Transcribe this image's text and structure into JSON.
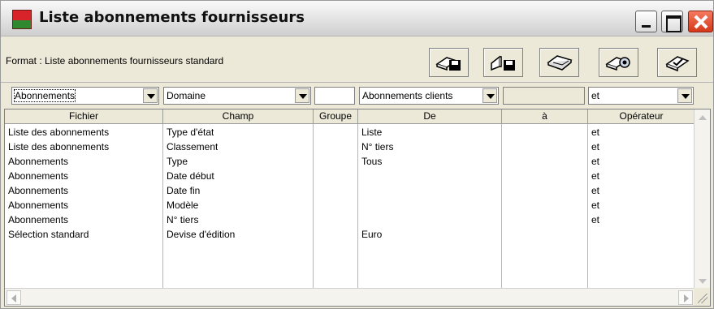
{
  "window": {
    "title": "Liste abonnements fournisseurs",
    "icon": "app-logo-icon",
    "controls": [
      "minimize-icon",
      "maximize-icon",
      "close-icon"
    ]
  },
  "format_label": "Format : Liste abonnements fournisseurs standard",
  "toolbar": {
    "buttons": [
      {
        "name": "save-format-button",
        "icon": "book-disk-icon"
      },
      {
        "name": "save-as-format-button",
        "icon": "open-book-disk-icon"
      },
      {
        "name": "open-format-button",
        "icon": "open-book-icon"
      },
      {
        "name": "preview-button",
        "icon": "book-search-icon"
      },
      {
        "name": "validate-button",
        "icon": "book-check-icon"
      }
    ]
  },
  "filters": {
    "fichier": "Abonnements",
    "champ": "Domaine",
    "groupe": "",
    "de": "Abonnements clients",
    "a": "",
    "operateur": "et"
  },
  "grid": {
    "columns": [
      "Fichier",
      "Champ",
      "Groupe",
      "De",
      "à",
      "Opérateur"
    ],
    "rows": [
      {
        "fichier": "Liste des abonnements",
        "champ": "Type d'état",
        "groupe": "",
        "de": "Liste",
        "a": "",
        "operateur": "et"
      },
      {
        "fichier": "Liste des abonnements",
        "champ": "Classement",
        "groupe": "",
        "de": "N° tiers",
        "a": "",
        "operateur": "et"
      },
      {
        "fichier": "Abonnements",
        "champ": "Type",
        "groupe": "",
        "de": "Tous",
        "a": "",
        "operateur": "et"
      },
      {
        "fichier": "Abonnements",
        "champ": "Date début",
        "groupe": "",
        "de": "",
        "a": "",
        "operateur": "et"
      },
      {
        "fichier": "Abonnements",
        "champ": "Date fin",
        "groupe": "",
        "de": "",
        "a": "",
        "operateur": "et"
      },
      {
        "fichier": "Abonnements",
        "champ": "Modèle",
        "groupe": "",
        "de": "",
        "a": "",
        "operateur": "et"
      },
      {
        "fichier": "Abonnements",
        "champ": "N° tiers",
        "groupe": "",
        "de": "",
        "a": "",
        "operateur": "et"
      },
      {
        "fichier": "Sélection standard",
        "champ": "Devise d'édition",
        "groupe": "",
        "de": "Euro",
        "a": "",
        "operateur": ""
      }
    ]
  },
  "colors": {
    "title_red": "#d8232a",
    "title_green": "#2f8a2f",
    "close_red": "#d4381a",
    "face": "#ece9d8"
  }
}
